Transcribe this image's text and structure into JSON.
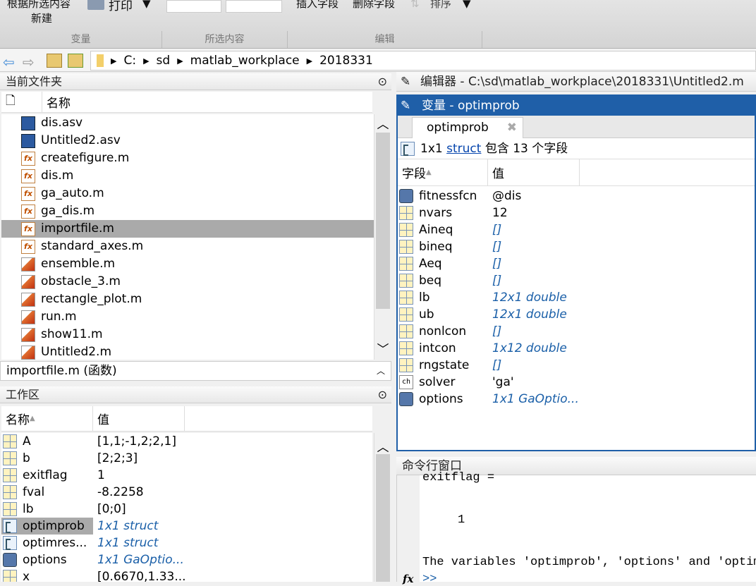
{
  "toolbar": {
    "new_from_selection": "根据所选内容",
    "new": "新建",
    "print": "打印",
    "insert_field": "插入字段",
    "delete_field": "删除字段",
    "sort": "排序",
    "groups": [
      "变量",
      "所选内容",
      "编辑"
    ]
  },
  "address": {
    "path": [
      "C:",
      "sd",
      "matlab_workplace",
      "2018331"
    ]
  },
  "current_folder": {
    "title": "当前文件夹",
    "col_name": "名称",
    "files": [
      {
        "name": "dis.asv",
        "type": "asv"
      },
      {
        "name": "Untitled2.asv",
        "type": "asv"
      },
      {
        "name": "createfigure.m",
        "type": "fx"
      },
      {
        "name": "dis.m",
        "type": "fx"
      },
      {
        "name": "ga_auto.m",
        "type": "fx"
      },
      {
        "name": "ga_dis.m",
        "type": "fx"
      },
      {
        "name": "importfile.m",
        "type": "fx",
        "selected": true
      },
      {
        "name": "standard_axes.m",
        "type": "fx"
      },
      {
        "name": "ensemble.m",
        "type": "m"
      },
      {
        "name": "obstacle_3.m",
        "type": "m"
      },
      {
        "name": "rectangle_plot.m",
        "type": "m"
      },
      {
        "name": "run.m",
        "type": "m"
      },
      {
        "name": "show11.m",
        "type": "m"
      },
      {
        "name": "Untitled2.m",
        "type": "m"
      }
    ],
    "details": "importfile.m  (函数)"
  },
  "workspace": {
    "title": "工作区",
    "col_name": "名称",
    "col_value": "值",
    "vars": [
      {
        "name": "A",
        "value": "[1,1;-1,2;2,1]",
        "type": "grid"
      },
      {
        "name": "b",
        "value": "[2;2;3]",
        "type": "grid"
      },
      {
        "name": "exitflag",
        "value": "1",
        "type": "grid"
      },
      {
        "name": "fval",
        "value": "-8.2258",
        "type": "grid"
      },
      {
        "name": "lb",
        "value": "[0;0]",
        "type": "grid"
      },
      {
        "name": "optimprob",
        "value": "1x1 struct",
        "type": "struct",
        "italic": true,
        "selected": true
      },
      {
        "name": "optimres...",
        "value": "1x1 struct",
        "type": "struct",
        "italic": true
      },
      {
        "name": "options",
        "value": "1x1 GaOptio...",
        "type": "obj",
        "italic": true
      },
      {
        "name": "x",
        "value": "[0.6670,1.33...",
        "type": "grid"
      }
    ]
  },
  "editor": {
    "title": "编辑器 - C:\\sd\\matlab_workplace\\2018331\\Untitled2.m"
  },
  "variables": {
    "title": "变量 - optimprob",
    "tab": "optimprob",
    "info_prefix": "1x1 ",
    "info_link": "struct",
    "info_suffix": " 包含 13 个字段",
    "col_field": "字段",
    "col_value": "值",
    "fields": [
      {
        "name": "fitnessfcn",
        "value": "@dis",
        "type": "obj"
      },
      {
        "name": "nvars",
        "value": "12",
        "type": "grid"
      },
      {
        "name": "Aineq",
        "value": "[]",
        "type": "grid",
        "italic": true
      },
      {
        "name": "bineq",
        "value": "[]",
        "type": "grid",
        "italic": true
      },
      {
        "name": "Aeq",
        "value": "[]",
        "type": "grid",
        "italic": true
      },
      {
        "name": "beq",
        "value": "[]",
        "type": "grid",
        "italic": true
      },
      {
        "name": "lb",
        "value": "12x1 double",
        "type": "grid",
        "italic": true
      },
      {
        "name": "ub",
        "value": "12x1 double",
        "type": "grid",
        "italic": true
      },
      {
        "name": "nonlcon",
        "value": "[]",
        "type": "grid",
        "italic": true
      },
      {
        "name": "intcon",
        "value": "1x12 double",
        "type": "grid",
        "italic": true
      },
      {
        "name": "rngstate",
        "value": "[]",
        "type": "grid",
        "italic": true
      },
      {
        "name": "solver",
        "value": "'ga'",
        "type": "ch"
      },
      {
        "name": "options",
        "value": "1x1 GaOptio...",
        "type": "obj",
        "italic": true
      }
    ]
  },
  "command": {
    "title": "命令行窗口",
    "lines": [
      "exitflag =",
      "1",
      "The variables 'optimprob', 'options' and 'optimr"
    ],
    "prompt": ">>",
    "fx": "fx"
  },
  "colors": {
    "selection": "#aaaaaa",
    "accent_blue": "#1f5fa8",
    "link": "#1a5fa8"
  }
}
